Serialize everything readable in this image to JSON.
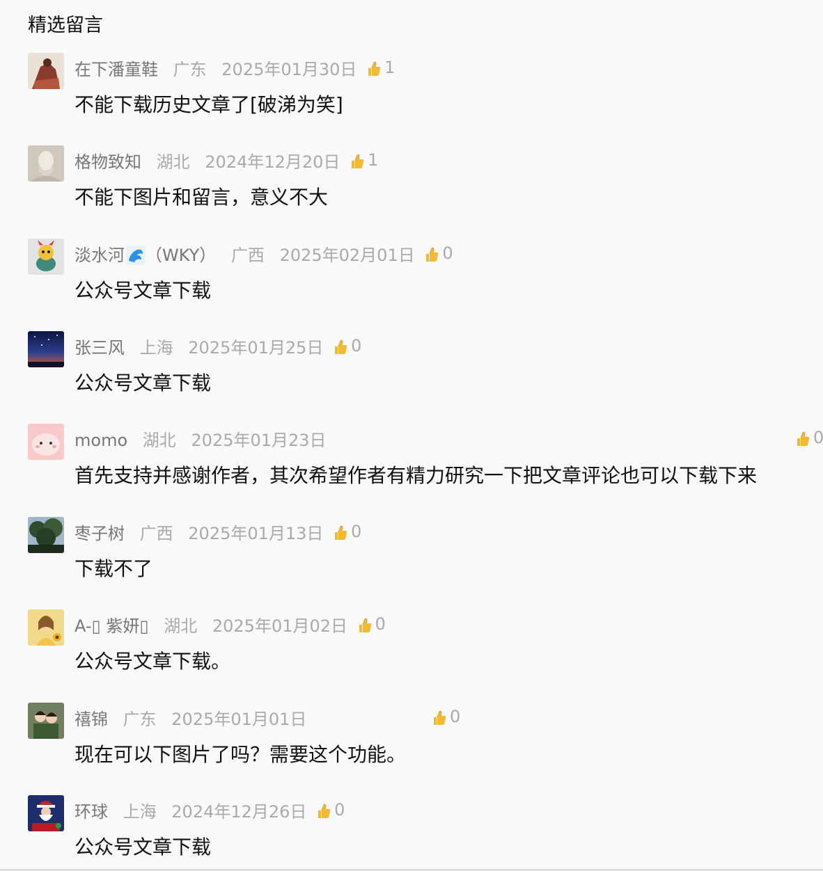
{
  "section": {
    "title": "精选留言"
  },
  "colors": {
    "thumb": "#f5b931",
    "meta_gray": "#aaaaaa",
    "name_gray": "#777777",
    "text": "#111111",
    "background": "#f9f9f9"
  },
  "comments": [
    {
      "nickname": "在下潘童鞋",
      "region": "广东",
      "date": "2025年01月30日",
      "likes": "1",
      "content": "不能下载历史文章了[破涕为笑]",
      "avatar_icon": "avatar-knight-art"
    },
    {
      "nickname": "格物致知",
      "region": "湖北",
      "date": "2024年12月20日",
      "likes": "1",
      "content": "不能下图片和留言，意义不大",
      "avatar_icon": "avatar-statue-bust"
    },
    {
      "nickname": "淡水河",
      "nickname_suffix": "（WKY）",
      "region": "广西",
      "date": "2025年02月01日",
      "likes": "0",
      "content": "公众号文章下载",
      "avatar_icon": "avatar-toy-figure",
      "name_icon": "wave-icon"
    },
    {
      "nickname": "张三风",
      "region": "上海",
      "date": "2025年01月25日",
      "likes": "0",
      "content": "公众号文章下载",
      "avatar_icon": "avatar-night-sky"
    },
    {
      "nickname": "momo",
      "region": "湖北",
      "date": "2025年01月23日",
      "likes": "0",
      "content": "首先支持并感谢作者，其次希望作者有精力研究一下把文章评论也可以下载下来",
      "avatar_icon": "avatar-pink-cartoon"
    },
    {
      "nickname": "枣子树",
      "region": "广西",
      "date": "2025年01月13日",
      "likes": "0",
      "content": "下载不了",
      "avatar_icon": "avatar-trees"
    },
    {
      "nickname": "A-▯ 紫妍▯",
      "region": "湖北",
      "date": "2025年01月02日",
      "likes": "0",
      "content": "公众号文章下载。",
      "avatar_icon": "avatar-girl-sunflower"
    },
    {
      "nickname": "禧锦",
      "region": "广东",
      "date": "2025年01月01日",
      "likes": "0",
      "content": "现在可以下图片了吗？需要这个功能。",
      "avatar_icon": "avatar-two-kids"
    },
    {
      "nickname": "环球",
      "region": "上海",
      "date": "2024年12月26日",
      "likes": "0",
      "content": "公众号文章下载",
      "avatar_icon": "avatar-santa"
    }
  ]
}
